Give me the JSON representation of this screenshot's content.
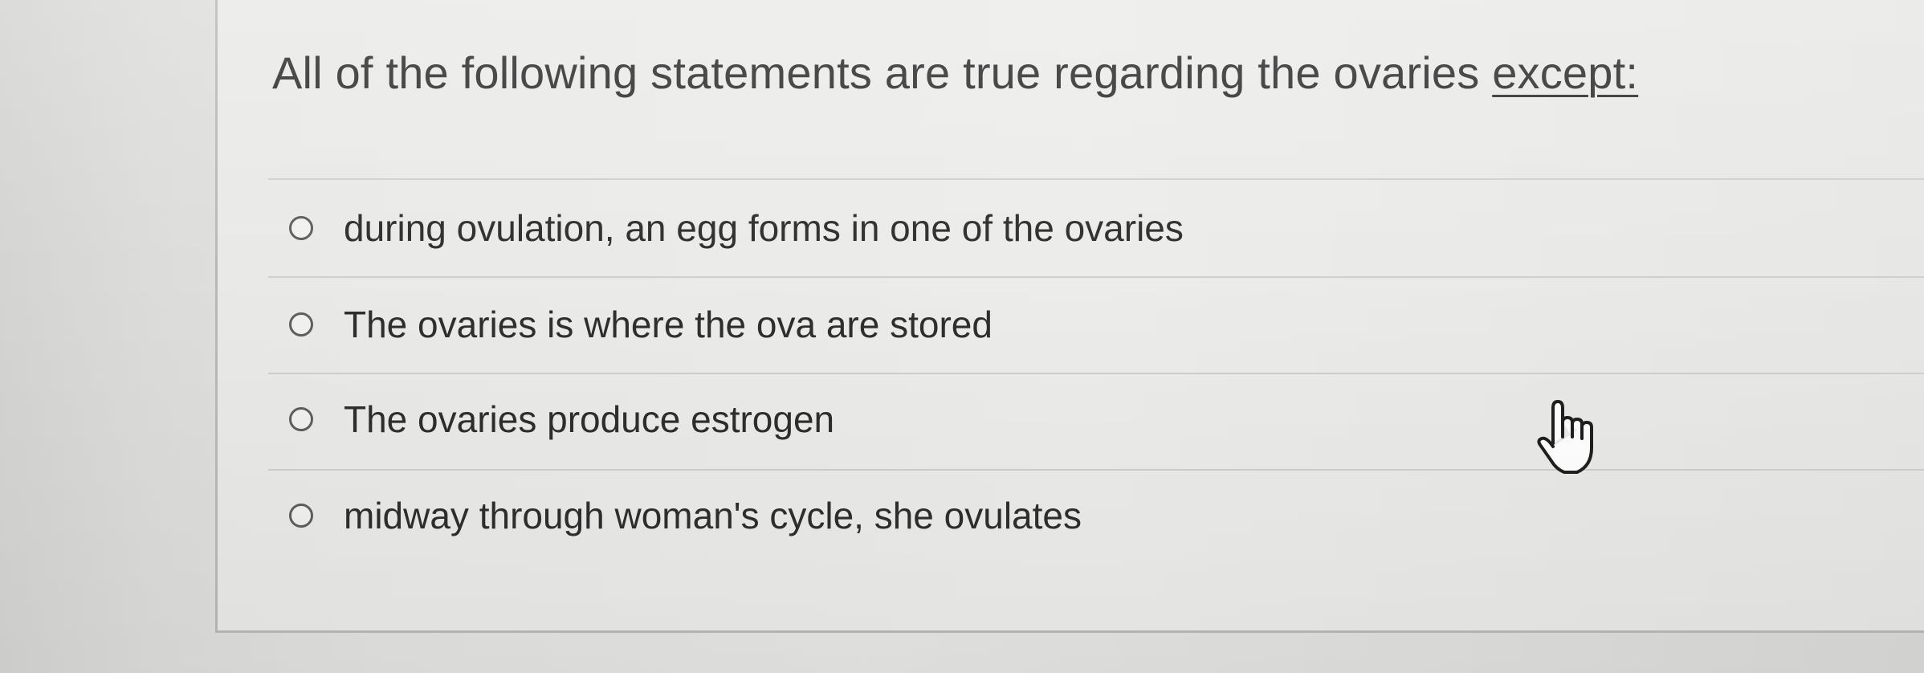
{
  "question": {
    "prompt": "All of the following statements are true regarding the ovaries ",
    "emphasis": "except:"
  },
  "options": [
    {
      "label": "during ovulation, an egg forms in one of the ovaries",
      "selected": false
    },
    {
      "label": "The ovaries is where the ova are stored",
      "selected": false
    },
    {
      "label": "The ovaries produce estrogen",
      "selected": false
    },
    {
      "label": "midway through woman's cycle, she ovulates",
      "selected": false
    }
  ],
  "cursor": {
    "icon": "hand-pointer-icon"
  },
  "colors": {
    "text": "#2e2e2e",
    "radio_border": "#5e5e5e",
    "divider": "#cfcfcd"
  }
}
